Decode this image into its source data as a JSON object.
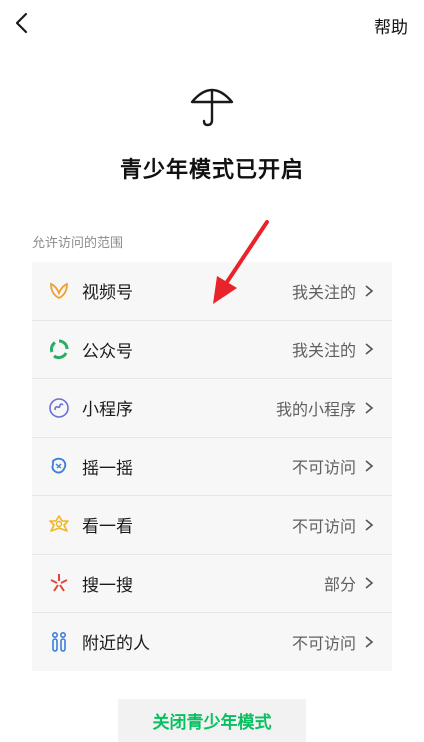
{
  "topbar": {
    "help_label": "帮助"
  },
  "header": {
    "title": "青少年模式已开启"
  },
  "section": {
    "label": "允许访问的范围"
  },
  "rows": [
    {
      "label": "视频号",
      "value": "我关注的",
      "icon": "channels-icon",
      "color": "#f0a030"
    },
    {
      "label": "公众号",
      "value": "我关注的",
      "icon": "official-accounts-icon",
      "color": "#2aae67"
    },
    {
      "label": "小程序",
      "value": "我的小程序",
      "icon": "mini-program-icon",
      "color": "#6b6fd6"
    },
    {
      "label": "摇一摇",
      "value": "不可访问",
      "icon": "shake-icon",
      "color": "#3d7fd8"
    },
    {
      "label": "看一看",
      "value": "不可访问",
      "icon": "top-stories-icon",
      "color": "#f2b620"
    },
    {
      "label": "搜一搜",
      "value": "部分",
      "icon": "search-icon",
      "color": "#e0453a"
    },
    {
      "label": "附近的人",
      "value": "不可访问",
      "icon": "people-nearby-icon",
      "color": "#3d7fd8"
    }
  ],
  "footer": {
    "close_button_label": "关闭青少年模式"
  },
  "colors": {
    "accent": "#07c160",
    "annotation_arrow": "#e8232a"
  }
}
